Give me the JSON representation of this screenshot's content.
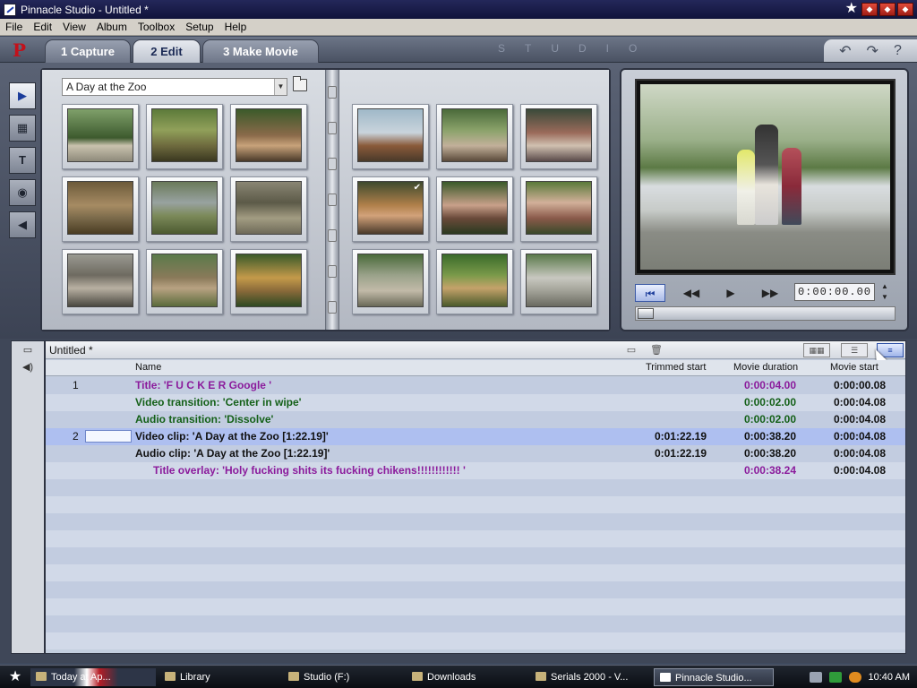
{
  "window": {
    "title": "Pinnacle Studio - Untitled *"
  },
  "menu": [
    "File",
    "Edit",
    "View",
    "Album",
    "Toolbox",
    "Setup",
    "Help"
  ],
  "tabs": {
    "capture": "1 Capture",
    "edit": "2 Edit",
    "make_movie": "3 Make Movie",
    "brand": "STUDIO"
  },
  "album": {
    "selected": "A Day at the Zoo",
    "scene_count": 18
  },
  "player": {
    "timecode": "0:00:00.00",
    "position_fraction": 0.0
  },
  "list": {
    "project_title": "Untitled *",
    "columns": {
      "name": "Name",
      "trimmed_start": "Trimmed start",
      "movie_duration": "Movie duration",
      "movie_start": "Movie start"
    },
    "rows": [
      {
        "num": "1",
        "name": "Title: 'F U C K E R Google '",
        "trimmed": "",
        "duration": "0:00:04.00",
        "start": "0:00:00.08",
        "kind": "title"
      },
      {
        "num": "",
        "name": "Video transition: 'Center in wipe'",
        "trimmed": "",
        "duration": "0:00:02.00",
        "start": "0:00:04.08",
        "kind": "trans"
      },
      {
        "num": "",
        "name": "Audio transition: 'Dissolve'",
        "trimmed": "",
        "duration": "0:00:02.00",
        "start": "0:00:04.08",
        "kind": "trans"
      },
      {
        "num": "2",
        "name": "Video clip: 'A Day at the Zoo [1:22.19]'",
        "trimmed": "0:01:22.19",
        "duration": "0:00:38.20",
        "start": "0:00:04.08",
        "kind": "video"
      },
      {
        "num": "",
        "name": "Audio clip: 'A Day at the Zoo [1:22.19]'",
        "trimmed": "0:01:22.19",
        "duration": "0:00:38.20",
        "start": "0:00:04.08",
        "kind": "audio"
      },
      {
        "num": "",
        "name": "Title overlay: 'Holy fucking shits its fucking chikens!!!!!!!!!!!! '",
        "trimmed": "",
        "duration": "0:00:38.24",
        "start": "0:00:04.08",
        "kind": "overlay"
      }
    ]
  },
  "taskbar": {
    "items": [
      "Today at Ap...",
      "Library",
      "Studio (F:)",
      "Downloads",
      "Serials 2000 - V...",
      "Pinnacle Studio..."
    ],
    "clock": "10:40 AM"
  },
  "colors": {
    "title_text": "#8b1b9c",
    "transition_text": "#146018",
    "accent": "#1b3c9a"
  }
}
